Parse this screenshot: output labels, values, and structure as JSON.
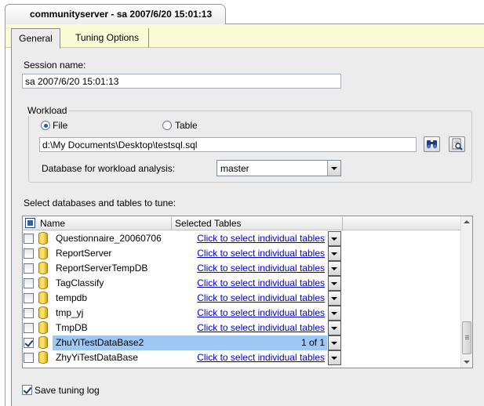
{
  "document_tab": {
    "title": "communityserver - sa 2007/6/20 15:01:13"
  },
  "tabs": [
    {
      "label": "General",
      "selected": true
    },
    {
      "label": "Tuning Options",
      "selected": false
    }
  ],
  "session": {
    "label": "Session name:",
    "value": "sa 2007/6/20 15:01:13"
  },
  "workload": {
    "group_label": "Workload",
    "file_option": "File",
    "table_option": "Table",
    "selected_option": "File",
    "file_path": "d:\\My Documents\\Desktop\\testsql.sql",
    "database_label": "Database for workload analysis:",
    "database_value": "master"
  },
  "grid": {
    "caption": "Select databases and tables to tune:",
    "columns": {
      "name": "Name",
      "selected_tables": "Selected Tables"
    },
    "rows": [
      {
        "name": "Questionnaire_20060706",
        "tables": "Click to select individual tables",
        "checked": false,
        "selected": false
      },
      {
        "name": "ReportServer",
        "tables": "Click to select individual tables",
        "checked": false,
        "selected": false
      },
      {
        "name": "ReportServerTempDB",
        "tables": "Click to select individual tables",
        "checked": false,
        "selected": false
      },
      {
        "name": "TagClassify",
        "tables": "Click to select individual tables",
        "checked": false,
        "selected": false
      },
      {
        "name": "tempdb",
        "tables": "Click to select individual tables",
        "checked": false,
        "selected": false
      },
      {
        "name": "tmp_yj",
        "tables": "Click to select individual tables",
        "checked": false,
        "selected": false
      },
      {
        "name": "TmpDB",
        "tables": "Click to select individual tables",
        "checked": false,
        "selected": false
      },
      {
        "name": "ZhuYiTestDataBase2",
        "tables": "1 of 1",
        "checked": true,
        "selected": true
      },
      {
        "name": "ZhyYiTestDataBase",
        "tables": "Click to select individual tables",
        "checked": false,
        "selected": false
      }
    ]
  },
  "save_log": {
    "label": "Save tuning log",
    "checked": true
  },
  "colors": {
    "selection": "#9fc7f4",
    "link": "#0000cc",
    "tabstrip": "#fbfbd6",
    "panel": "#ececec"
  },
  "icons": [
    "database-icon",
    "browse-binoculars-icon",
    "preview-document-icon",
    "dropdown-arrow-icon",
    "radio-icon",
    "checkbox-icon"
  ]
}
